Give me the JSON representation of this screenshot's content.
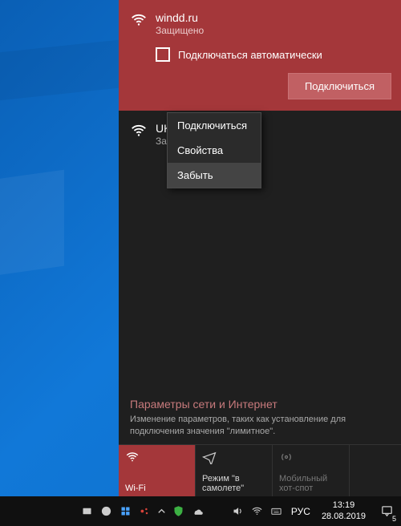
{
  "networks": {
    "selected": {
      "ssid": "windd.ru",
      "status": "Защищено",
      "auto_label": "Подключаться автоматически",
      "connect_btn": "Подключиться"
    },
    "other": {
      "ssid_visible": "UKr",
      "status": "Зac"
    }
  },
  "context_menu": {
    "items": [
      "Подключиться",
      "Свойства",
      "Забыть"
    ],
    "hovered_index": 2
  },
  "settings": {
    "title": "Параметры сети и Интернет",
    "desc": "Изменение параметров, таких как установление для подключения значения \"лимитное\"."
  },
  "tiles": {
    "wifi": "Wi-Fi",
    "airplane": "Режим \"в самолете\"",
    "hotspot": "Мобильный хот-спот"
  },
  "taskbar": {
    "lang": "РУС",
    "time": "13:19",
    "date": "28.08.2019",
    "notif_count": "5"
  }
}
